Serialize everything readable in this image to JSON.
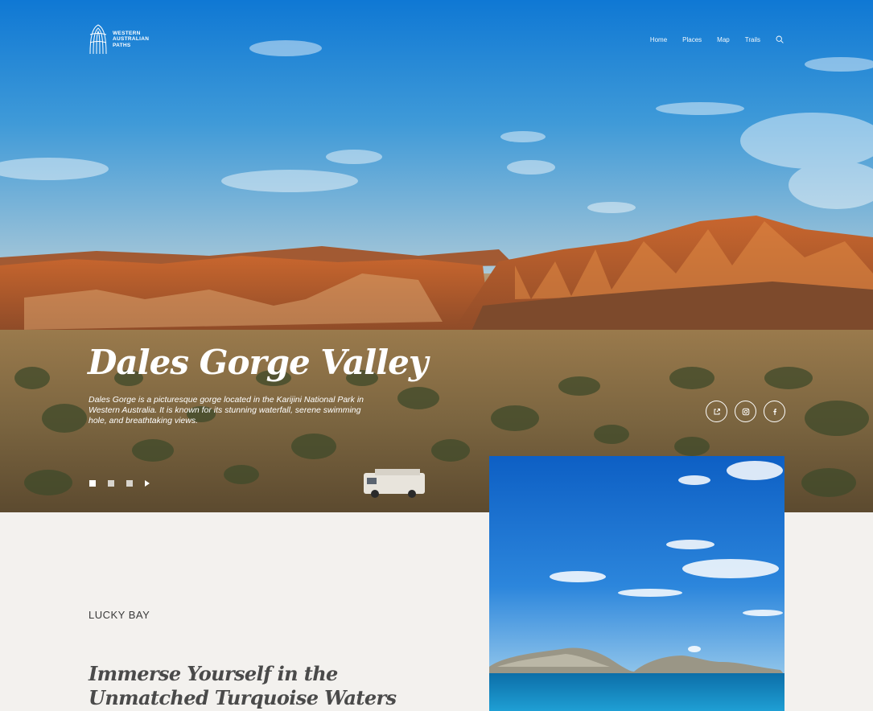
{
  "brand": {
    "logo_lines": [
      "WESTERN",
      "AUSTRALIAN",
      "PATHS"
    ]
  },
  "nav": {
    "items": [
      "Home",
      "Places",
      "Map",
      "Trails"
    ],
    "search_icon": "search-icon"
  },
  "hero": {
    "title": "Dales Gorge Valley",
    "description": "Dales Gorge is a picturesque gorge located in the Karijini National Park in Western Australia. It is known for its stunning waterfall, serene swimming hole, and breathtaking views.",
    "social_icons": [
      "share-icon",
      "instagram-icon",
      "facebook-icon"
    ],
    "slides": {
      "count": 3,
      "active_index": 0
    }
  },
  "section": {
    "label": "LUCKY BAY",
    "heading_line1": "Immerse Yourself in the",
    "heading_line2": "Unmatched Turquoise Waters"
  },
  "colors": {
    "page_bg": "#f3f1ee",
    "sky": "#1a7fd6",
    "rock": "#b35a2a",
    "water": "#1a8fc7"
  }
}
